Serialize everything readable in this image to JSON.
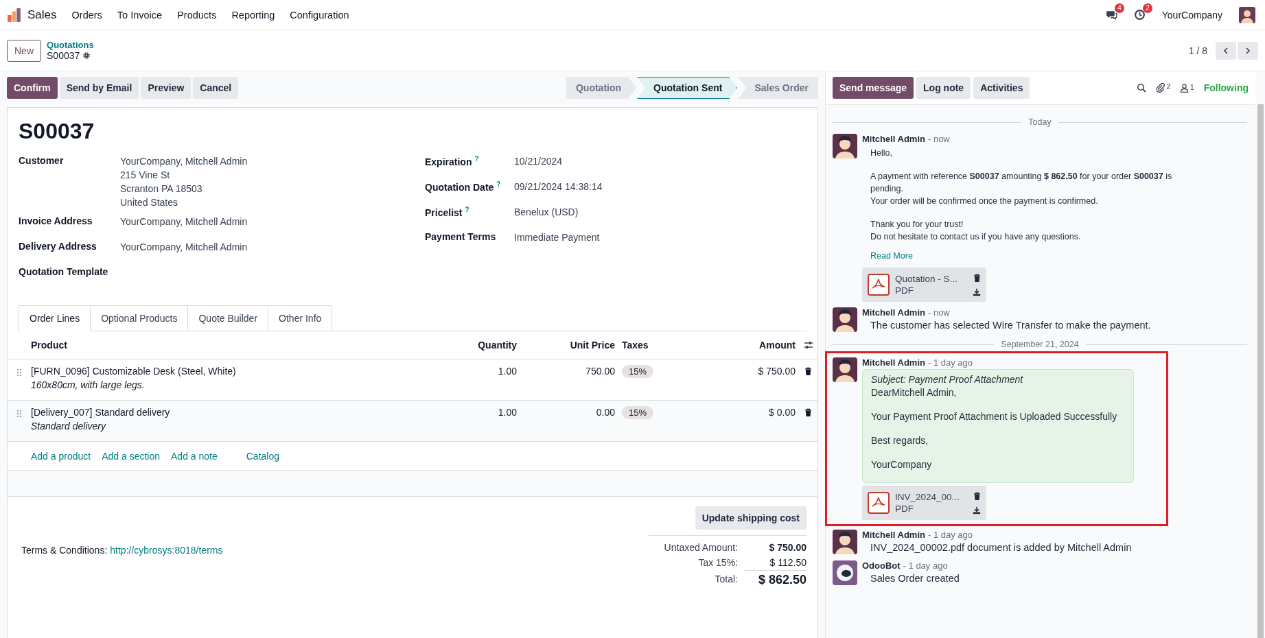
{
  "navbar": {
    "app_name": "Sales",
    "menu": [
      "Orders",
      "To Invoice",
      "Products",
      "Reporting",
      "Configuration"
    ],
    "messages_badge": "4",
    "activities_badge": "2",
    "company": "YourCompany"
  },
  "control_panel": {
    "new_button": "New",
    "breadcrumb_parent": "Quotations",
    "breadcrumb_current": "S00037",
    "pager": "1 / 8"
  },
  "actions": [
    {
      "label": "Confirm",
      "primary": true
    },
    {
      "label": "Send by Email",
      "primary": false
    },
    {
      "label": "Preview",
      "primary": false
    },
    {
      "label": "Cancel",
      "primary": false
    }
  ],
  "stages": [
    {
      "label": "Quotation",
      "selected": false
    },
    {
      "label": "Quotation Sent",
      "selected": true
    },
    {
      "label": "Sales Order",
      "selected": false
    }
  ],
  "form": {
    "title": "S00037",
    "left_fields": [
      {
        "label": "Customer",
        "lines": [
          "YourCompany, Mitchell Admin",
          "215 Vine St",
          "Scranton PA 18503",
          "United States"
        ]
      },
      {
        "label": "Invoice Address",
        "lines": [
          "YourCompany, Mitchell Admin"
        ]
      },
      {
        "label": "Delivery Address",
        "lines": [
          "YourCompany, Mitchell Admin"
        ]
      },
      {
        "label": "Quotation Template"
      }
    ],
    "right_fields": [
      {
        "label": "Expiration",
        "help": "?",
        "lines": [
          "10/21/2024"
        ]
      },
      {
        "label": "Quotation Date",
        "help": "?",
        "lines": [
          "09/21/2024 14:38:14"
        ]
      },
      {
        "label": "Pricelist",
        "help": "?",
        "lines": [
          "Benelux (USD)"
        ]
      },
      {
        "label": "Payment Terms",
        "lines": [
          "Immediate Payment"
        ]
      }
    ]
  },
  "tabs": [
    {
      "label": "Order Lines",
      "selected": true
    },
    {
      "label": "Optional Products",
      "selected": false
    },
    {
      "label": "Quote Builder",
      "selected": false
    },
    {
      "label": "Other Info",
      "selected": false
    }
  ],
  "table": {
    "columns": [
      "Product",
      "Quantity",
      "Unit Price",
      "Taxes",
      "Amount"
    ],
    "rows": [
      {
        "product": "[FURN_0096] Customizable Desk (Steel, White)",
        "description": "160x80cm, with large legs.",
        "quantity": "1.00",
        "unit_price": "750.00",
        "tax": "15%",
        "amount": "$ 750.00"
      },
      {
        "product": "[Delivery_007] Standard delivery",
        "description": "Standard delivery",
        "quantity": "1.00",
        "unit_price": "0.00",
        "tax": "15%",
        "amount": "$ 0.00"
      }
    ],
    "add_links": [
      "Add a product",
      "Add a section",
      "Add a note",
      "Catalog"
    ]
  },
  "update_shipping": "Update shipping cost",
  "terms": {
    "label": "Terms & Conditions:",
    "link": "http://cybrosys:8018/terms"
  },
  "totals": [
    {
      "label": "Untaxed Amount:",
      "value": "$ 750.00",
      "kind": "bold"
    },
    {
      "label": "Tax 15%:",
      "value": "$ 112.50",
      "kind": "normal"
    },
    {
      "label": "Total:",
      "value": "$ 862.50",
      "kind": "total"
    }
  ],
  "chatter": {
    "buttons": [
      {
        "label": "Send message",
        "primary": true
      },
      {
        "label": "Log note",
        "primary": false
      },
      {
        "label": "Activities",
        "primary": false
      }
    ],
    "attachments_count": "2",
    "followers_count": "1",
    "following": "Following",
    "groups": [
      {
        "date": "Today",
        "messages": [
          {
            "kind": "user",
            "author": "Mitchell Admin",
            "time": "- now",
            "highlighted": false,
            "body": {
              "kind": "plain",
              "paragraphs": [
                [
                  "Hello,"
                ],
                [
                  "A payment with reference **S00037** amounting **$ 862.50** for your order **S00037** is pending.",
                  "Your order will be confirmed once the payment is confirmed."
                ],
                [
                  "Thank you for your trust!",
                  "Do not hesitate to contact us if you have any questions."
                ]
              ]
            },
            "read_more": "Read More",
            "attachments": [
              {
                "name": "Quotation - S...",
                "type": "PDF"
              }
            ]
          },
          {
            "kind": "user",
            "author": "Mitchell Admin",
            "time": "- now",
            "highlighted": false,
            "body": {
              "kind": "note",
              "paragraphs": [
                [
                  "The customer has selected Wire Transfer to make the payment."
                ]
              ]
            }
          }
        ]
      },
      {
        "date": "September 21, 2024",
        "messages": [
          {
            "kind": "user",
            "author": "Mitchell Admin",
            "time": "- 1 day ago",
            "highlighted": true,
            "body": {
              "kind": "bubble",
              "subject": "Subject: Payment Proof Attachment",
              "paragraphs": [
                [
                  "DearMitchell Admin,"
                ],
                [
                  "Your Payment Proof Attachment is Uploaded Successfully"
                ],
                [
                  "Best regards,"
                ],
                [
                  "YourCompany"
                ]
              ]
            },
            "attachments": [
              {
                "name": "INV_2024_00...",
                "type": "PDF"
              }
            ]
          },
          {
            "kind": "user",
            "author": "Mitchell Admin",
            "time": "- 1 day ago",
            "highlighted": false,
            "body": {
              "kind": "note",
              "paragraphs": [
                [
                  "INV_2024_00002.pdf document is added by Mitchell Admin"
                ]
              ]
            }
          },
          {
            "kind": "bot",
            "author": "OdooBot",
            "time": "- 1 day ago",
            "highlighted": false,
            "body": {
              "kind": "note",
              "paragraphs": [
                [
                  "Sales Order created"
                ]
              ]
            }
          }
        ]
      }
    ]
  }
}
